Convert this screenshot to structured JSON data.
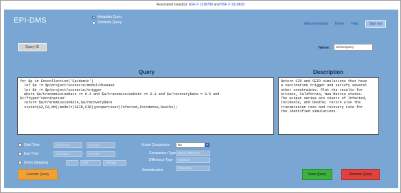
{
  "grant_bar": {
    "prefix": "Associated Grant(s):",
    "grant_1": "NSF # 1318788",
    "joiner": "and",
    "grant_2": "NSF # 1518839"
  },
  "app": {
    "brand": "EPI-DMS",
    "query_type_options": [
      "Metadata Query",
      "Similarity Query"
    ],
    "selected_query_type": "Metadata Query"
  },
  "nav": {
    "welcome": "Welcome Guest",
    "home": "Home",
    "help": "Help",
    "signout": "Sign out"
  },
  "query_id_button": "Query ID",
  "name_field": {
    "label": "Name:",
    "value": "SeirsInQuery"
  },
  "query": {
    "title": "Query",
    "text": "for $p in Envcollection('Epidemic')\n  let $a := $p/project/scenario/model/disease\n  let $t := $p/project/scenario/trigger\n  where $a/transmissionRate <= 0.4 and $a/transmissionRate >= 0.3 and $a/recoveryRate = 0.5 and\n$t/ftype='Vaccination'\n  return $a/transmissionRate,$a/recoveryRate\n  state=(AZ,CA,NM);model=(SEIR,SIR);properties=(Infected,Incidence,Deaths);"
  },
  "description": {
    "title": "Description",
    "text": "Return SIR and SEIR simulations that have\na vaccination trigger and satisfy several\nother constraints. Plot the results for\nArizona, California, New Mexico states.\nThe output series are counts of Infected,\nIncidence, and Deaths; return also the\ntransmission rate and recovery rate for\nthe identified simulations."
  },
  "controls": {
    "start_time": {
      "label": "Start Time",
      "date": "2012-01-01",
      "time": "12:00:00"
    },
    "end_time": {
      "label": "End Time",
      "date": "2012-08-31",
      "time": "12:00:00"
    },
    "down_sampling": {
      "label": "Down Sampling",
      "amount": "1",
      "unit": "Day",
      "method": "Average"
    },
    "visual_comparison": {
      "label": "Visual Comparison",
      "value": "No"
    },
    "comparison_type": {
      "label": "Comparison Type",
      "value": "Mean Difference"
    },
    "difference_type": {
      "label": "Difference Type",
      "value": "Absolute"
    },
    "normalization": {
      "label": "Normalization",
      "value": "Meanptsp"
    }
  },
  "buttons": {
    "execute": "Execute Query",
    "save": "Save Query",
    "remove": "Remove Query"
  },
  "colors": {
    "app_background": "#7aa6d3",
    "execute": "#f0a23a",
    "save": "#3db13d",
    "remove": "#e0423e",
    "select_accent": "#2a67c9"
  }
}
